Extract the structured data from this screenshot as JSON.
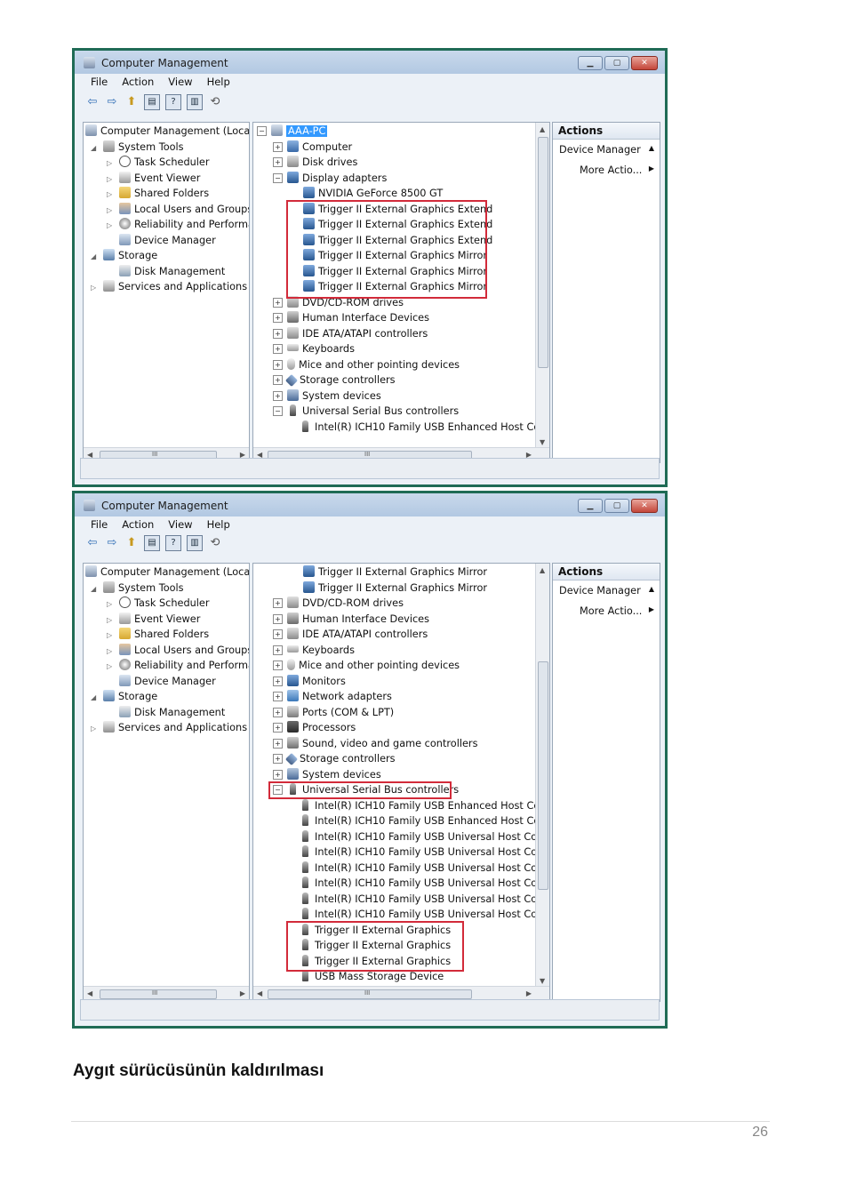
{
  "window1": {
    "title": "Computer Management",
    "menu": [
      "File",
      "Action",
      "View",
      "Help"
    ],
    "left_tree": [
      {
        "label": "Computer Management (Local",
        "icon": "computer-management-icon"
      },
      {
        "label": "System Tools",
        "icon": "tools-icon"
      },
      {
        "label": "Task Scheduler",
        "icon": "clock-icon"
      },
      {
        "label": "Event Viewer",
        "icon": "event-viewer-icon"
      },
      {
        "label": "Shared Folders",
        "icon": "folder-icon"
      },
      {
        "label": "Local Users and Groups",
        "icon": "users-icon"
      },
      {
        "label": "Reliability and Performa",
        "icon": "performance-icon"
      },
      {
        "label": "Device Manager",
        "icon": "device-manager-icon"
      },
      {
        "label": "Storage",
        "icon": "storage-icon"
      },
      {
        "label": "Disk Management",
        "icon": "disk-icon"
      },
      {
        "label": "Services and Applications",
        "icon": "services-icon"
      }
    ],
    "device_tree": [
      {
        "label": "AAA-PC",
        "icon": "pc-icon"
      },
      {
        "label": "Computer",
        "icon": "computer-icon"
      },
      {
        "label": "Disk drives",
        "icon": "drive-icon"
      },
      {
        "label": "Display adapters",
        "icon": "monitor-icon"
      },
      {
        "label": "NVIDIA GeForce 8500 GT",
        "icon": "monitor-icon"
      },
      {
        "label": "Trigger II External Graphics Extend",
        "icon": "monitor-icon"
      },
      {
        "label": "Trigger II External Graphics Extend",
        "icon": "monitor-icon"
      },
      {
        "label": "Trigger II External Graphics Extend",
        "icon": "monitor-icon"
      },
      {
        "label": "Trigger II External Graphics Mirror",
        "icon": "monitor-icon"
      },
      {
        "label": "Trigger II External Graphics Mirror",
        "icon": "monitor-icon"
      },
      {
        "label": "Trigger II External Graphics Mirror",
        "icon": "monitor-icon"
      },
      {
        "label": "DVD/CD-ROM drives",
        "icon": "drive-icon"
      },
      {
        "label": "Human Interface Devices",
        "icon": "hid-icon"
      },
      {
        "label": "IDE ATA/ATAPI controllers",
        "icon": "drive-icon"
      },
      {
        "label": "Keyboards",
        "icon": "keyboard-icon"
      },
      {
        "label": "Mice and other pointing devices",
        "icon": "mouse-icon"
      },
      {
        "label": "Storage controllers",
        "icon": "controller-icon"
      },
      {
        "label": "System devices",
        "icon": "system-icon"
      },
      {
        "label": "Universal Serial Bus controllers",
        "icon": "usb-icon"
      },
      {
        "label": "Intel(R) ICH10 Family USB Enhanced Host Con",
        "icon": "usb-icon"
      }
    ],
    "actions": {
      "header": "Actions",
      "section": "Device Manager",
      "more": "More Actio..."
    }
  },
  "window2": {
    "title": "Computer Management",
    "menu": [
      "File",
      "Action",
      "View",
      "Help"
    ],
    "left_tree": [
      {
        "label": "Computer Management (Local",
        "icon": "computer-management-icon"
      },
      {
        "label": "System Tools",
        "icon": "tools-icon"
      },
      {
        "label": "Task Scheduler",
        "icon": "clock-icon"
      },
      {
        "label": "Event Viewer",
        "icon": "event-viewer-icon"
      },
      {
        "label": "Shared Folders",
        "icon": "folder-icon"
      },
      {
        "label": "Local Users and Groups",
        "icon": "users-icon"
      },
      {
        "label": "Reliability and Performa",
        "icon": "performance-icon"
      },
      {
        "label": "Device Manager",
        "icon": "device-manager-icon"
      },
      {
        "label": "Storage",
        "icon": "storage-icon"
      },
      {
        "label": "Disk Management",
        "icon": "disk-icon"
      },
      {
        "label": "Services and Applications",
        "icon": "services-icon"
      }
    ],
    "device_tree": [
      {
        "label": "Trigger II External Graphics Mirror",
        "icon": "monitor-icon"
      },
      {
        "label": "Trigger II External Graphics Mirror",
        "icon": "monitor-icon"
      },
      {
        "label": "DVD/CD-ROM drives",
        "icon": "drive-icon"
      },
      {
        "label": "Human Interface Devices",
        "icon": "hid-icon"
      },
      {
        "label": "IDE ATA/ATAPI controllers",
        "icon": "drive-icon"
      },
      {
        "label": "Keyboards",
        "icon": "keyboard-icon"
      },
      {
        "label": "Mice and other pointing devices",
        "icon": "mouse-icon"
      },
      {
        "label": "Monitors",
        "icon": "monitor-icon"
      },
      {
        "label": "Network adapters",
        "icon": "network-icon"
      },
      {
        "label": "Ports (COM & LPT)",
        "icon": "port-icon"
      },
      {
        "label": "Processors",
        "icon": "processor-icon"
      },
      {
        "label": "Sound, video and game controllers",
        "icon": "sound-icon"
      },
      {
        "label": "Storage controllers",
        "icon": "controller-icon"
      },
      {
        "label": "System devices",
        "icon": "system-icon"
      },
      {
        "label": "Universal Serial Bus controllers",
        "icon": "usb-icon"
      },
      {
        "label": "Intel(R) ICH10 Family USB Enhanced Host Con",
        "icon": "usb-icon"
      },
      {
        "label": "Intel(R) ICH10 Family USB Enhanced Host Con",
        "icon": "usb-icon"
      },
      {
        "label": "Intel(R) ICH10 Family USB Universal Host Cont",
        "icon": "usb-icon"
      },
      {
        "label": "Intel(R) ICH10 Family USB Universal Host Cont",
        "icon": "usb-icon"
      },
      {
        "label": "Intel(R) ICH10 Family USB Universal Host Cont",
        "icon": "usb-icon"
      },
      {
        "label": "Intel(R) ICH10 Family USB Universal Host Cont",
        "icon": "usb-icon"
      },
      {
        "label": "Intel(R) ICH10 Family USB Universal Host Cont",
        "icon": "usb-icon"
      },
      {
        "label": "Intel(R) ICH10 Family USB Universal Host Cont",
        "icon": "usb-icon"
      },
      {
        "label": "Trigger II External Graphics",
        "icon": "usb-icon"
      },
      {
        "label": "Trigger II External Graphics",
        "icon": "usb-icon"
      },
      {
        "label": "Trigger II External Graphics",
        "icon": "usb-icon"
      },
      {
        "label": "USB Mass Storage Device",
        "icon": "usb-icon"
      }
    ],
    "actions": {
      "header": "Actions",
      "section": "Device Manager",
      "more": "More Actio..."
    }
  },
  "scroll_glyph": "III",
  "heading": "Aygıt sürücüsünün kaldırılması",
  "page_number": "26",
  "colors": {
    "highlight_box": "#d22b3a",
    "selection": "#3399ff",
    "window_border": "#1f6b55"
  }
}
